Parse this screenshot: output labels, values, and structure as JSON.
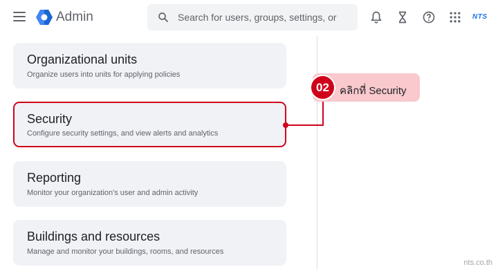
{
  "header": {
    "app_title": "Admin",
    "search": {
      "placeholder": "Search for users, groups, settings, or",
      "value": ""
    },
    "icons": [
      "menu-icon",
      "admin-logo-icon",
      "search-icon",
      "bell-icon",
      "hourglass-icon",
      "help-icon",
      "apps-grid-icon"
    ],
    "brand_mini": "NTS"
  },
  "cards": [
    {
      "title": "Organizational units",
      "description": "Organize users into units for applying policies"
    },
    {
      "title": "Security",
      "description": "Configure security settings, and view alerts and analytics"
    },
    {
      "title": "Reporting",
      "description": "Monitor your organization's user and admin activity"
    },
    {
      "title": "Buildings and resources",
      "description": "Manage and monitor your buildings, rooms, and resources"
    }
  ],
  "callout": {
    "step": "02",
    "text": "คลิกที่ Security"
  },
  "watermark": "nts.co.th",
  "colors": {
    "highlight": "#d0021b",
    "callout_bg": "#f9c9cd",
    "card_bg": "#f0f2f6",
    "accent": "#1a73e8"
  }
}
